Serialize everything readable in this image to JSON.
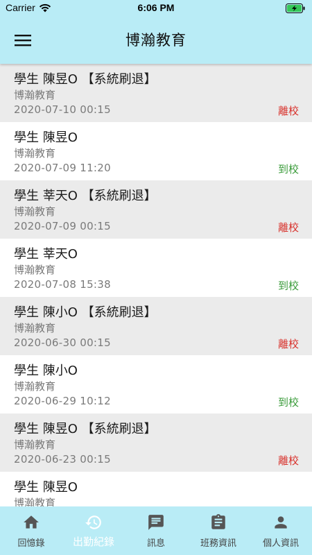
{
  "status_bar": {
    "carrier": "Carrier",
    "time": "6:06 PM"
  },
  "header": {
    "title": "博瀚教育"
  },
  "colors": {
    "header_bg": "#b9ecf6",
    "leave": "#d8322c",
    "arrive": "#3a9b3a",
    "alt_row": "#ebebeb"
  },
  "records": [
    {
      "name": "學生 陳昱O 【系統刷退】",
      "school": "博瀚教育",
      "time": "2020-07-10 00:15",
      "status": "離校",
      "type": "leave"
    },
    {
      "name": "學生 陳昱O",
      "school": "博瀚教育",
      "time": "2020-07-09 11:20",
      "status": "到校",
      "type": "arrive"
    },
    {
      "name": "學生 莘天O 【系統刷退】",
      "school": "博瀚教育",
      "time": "2020-07-09 00:15",
      "status": "離校",
      "type": "leave"
    },
    {
      "name": "學生 莘天O",
      "school": "博瀚教育",
      "time": "2020-07-08 15:38",
      "status": "到校",
      "type": "arrive"
    },
    {
      "name": "學生 陳小O 【系統刷退】",
      "school": "博瀚教育",
      "time": "2020-06-30 00:15",
      "status": "離校",
      "type": "leave"
    },
    {
      "name": "學生 陳小O",
      "school": "博瀚教育",
      "time": "2020-06-29 10:12",
      "status": "到校",
      "type": "arrive"
    },
    {
      "name": "學生 陳昱O 【系統刷退】",
      "school": "博瀚教育",
      "time": "2020-06-23 00:15",
      "status": "離校",
      "type": "leave"
    },
    {
      "name": "學生 陳昱O",
      "school": "博瀚教育",
      "time": "",
      "status": "",
      "type": "arrive"
    }
  ],
  "bottom_nav": [
    {
      "label": "回憶錄",
      "icon": "home-icon",
      "active": false
    },
    {
      "label": "出勤紀錄",
      "icon": "history-icon",
      "active": true
    },
    {
      "label": "訊息",
      "icon": "message-icon",
      "active": false
    },
    {
      "label": "班務資訊",
      "icon": "clipboard-icon",
      "active": false
    },
    {
      "label": "個人資訊",
      "icon": "person-icon",
      "active": false
    }
  ]
}
